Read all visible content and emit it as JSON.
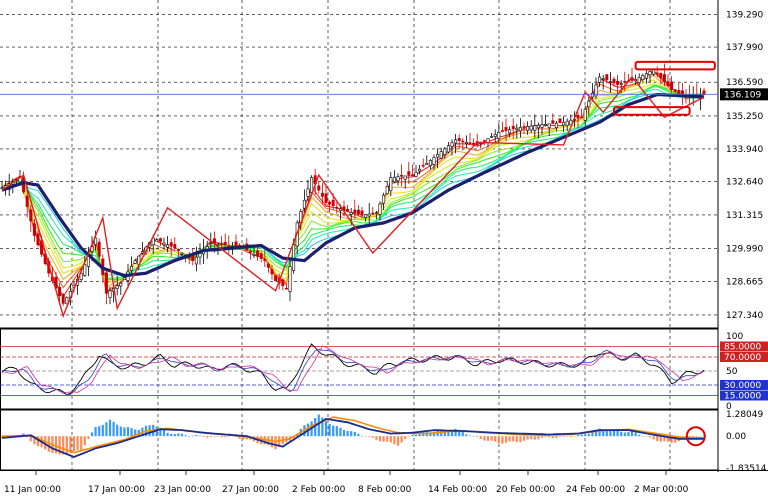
{
  "price_axis": {
    "labels": [
      "139.290",
      "137.990",
      "136.590",
      "135.250",
      "133.940",
      "132.640",
      "131.315",
      "129.990",
      "128.665",
      "127.340"
    ],
    "values": [
      139.29,
      137.99,
      136.59,
      135.25,
      133.94,
      132.64,
      131.315,
      129.99,
      128.665,
      127.34
    ],
    "current_price": "136.109",
    "current_value": 136.109
  },
  "rsi_axis": {
    "labels": [
      "100",
      "85.0000",
      "70.0000",
      "50",
      "30.0000",
      "15.0000",
      "0"
    ],
    "values": [
      100,
      85,
      70,
      50,
      30,
      15,
      0
    ],
    "tagged": [
      false,
      true,
      true,
      false,
      true,
      true,
      false
    ]
  },
  "macd_axis": {
    "labels": [
      "1.28049",
      "0.00",
      "-1.83514"
    ],
    "values": [
      1.28049,
      0.0,
      -1.83514
    ]
  },
  "time_axis": {
    "labels": [
      "11 Jan 00:00",
      "17 Jan 00:00",
      "23 Jan 00:00",
      "27 Jan 00:00",
      "2 Feb 00:00",
      "8 Feb 00:00",
      "14 Feb 00:00",
      "20 Feb 00:00",
      "24 Feb 00:00",
      "2 Mar 00:00"
    ]
  },
  "colors": {
    "background": "#ffffff",
    "grid": "#000000",
    "bull_candle": "#000000",
    "bear_candle": "#cc0000",
    "ma_slow": "#1a1f6e",
    "zigzag": "#e02020",
    "current_line": "#4a6cd4",
    "rsi_level_high": "#cc2222",
    "rsi_level_low": "#2233cc",
    "macd_pos": "#3399ff",
    "macd_neg": "#ff8855",
    "macd_signal": "#ff8c00",
    "macd_line": "#1a2c8c",
    "annotation": "#e00000"
  },
  "chart_data": [
    {
      "type": "candlestick",
      "title": "",
      "x_labels": [
        "11 Jan 00:00",
        "17 Jan 00:00",
        "23 Jan 00:00",
        "27 Jan 00:00",
        "2 Feb 00:00",
        "8 Feb 00:00",
        "14 Feb 00:00",
        "20 Feb 00:00",
        "24 Feb 00:00",
        "2 Mar 00:00"
      ],
      "ylim": [
        126.9,
        139.7
      ],
      "ma_ribbon": "rainbow",
      "slow_ma_key": [
        [
          0,
          132.3
        ],
        [
          6,
          132.6
        ],
        [
          10,
          132.5
        ],
        [
          16,
          131.2
        ],
        [
          22,
          130.0
        ],
        [
          28,
          129.2
        ],
        [
          34,
          128.9
        ],
        [
          40,
          129.0
        ],
        [
          48,
          129.5
        ],
        [
          56,
          129.9
        ],
        [
          64,
          130.0
        ],
        [
          72,
          130.1
        ],
        [
          78,
          129.6
        ],
        [
          84,
          129.5
        ],
        [
          90,
          130.2
        ],
        [
          98,
          130.8
        ],
        [
          106,
          131.0
        ],
        [
          114,
          131.4
        ],
        [
          124,
          132.3
        ],
        [
          134,
          133.0
        ],
        [
          146,
          133.8
        ],
        [
          156,
          134.4
        ],
        [
          166,
          135.0
        ],
        [
          174,
          135.7
        ],
        [
          182,
          136.1
        ],
        [
          190,
          136.05
        ],
        [
          195,
          136.0
        ]
      ],
      "close_key": [
        [
          0,
          132.4
        ],
        [
          5,
          132.8
        ],
        [
          9,
          130.5
        ],
        [
          13,
          129.0
        ],
        [
          17,
          127.8
        ],
        [
          22,
          129.0
        ],
        [
          26,
          130.4
        ],
        [
          29,
          128.2
        ],
        [
          33,
          128.6
        ],
        [
          37,
          129.5
        ],
        [
          42,
          130.4
        ],
        [
          48,
          130.0
        ],
        [
          53,
          129.5
        ],
        [
          58,
          130.2
        ],
        [
          63,
          130.1
        ],
        [
          67,
          130.0
        ],
        [
          73,
          129.5
        ],
        [
          76,
          128.7
        ],
        [
          79,
          128.4
        ],
        [
          82,
          131.0
        ],
        [
          86,
          132.8
        ],
        [
          90,
          131.8
        ],
        [
          95,
          131.5
        ],
        [
          100,
          131.3
        ],
        [
          104,
          131.4
        ],
        [
          108,
          132.8
        ],
        [
          114,
          132.9
        ],
        [
          120,
          133.6
        ],
        [
          126,
          134.3
        ],
        [
          132,
          134.1
        ],
        [
          138,
          134.6
        ],
        [
          144,
          134.8
        ],
        [
          150,
          134.9
        ],
        [
          156,
          135.0
        ],
        [
          161,
          135.2
        ],
        [
          166,
          136.8
        ],
        [
          171,
          136.5
        ],
        [
          176,
          136.7
        ],
        [
          181,
          137.1
        ],
        [
          186,
          136.3
        ],
        [
          190,
          136.0
        ],
        [
          195,
          136.1
        ]
      ],
      "zigzag": [
        [
          0,
          132.3
        ],
        [
          6,
          132.9
        ],
        [
          17,
          127.3
        ],
        [
          28,
          131.2
        ],
        [
          32,
          127.6
        ],
        [
          46,
          131.6
        ],
        [
          76,
          128.3
        ],
        [
          88,
          132.9
        ],
        [
          103,
          129.8
        ],
        [
          132,
          134.2
        ],
        [
          156,
          134.1
        ],
        [
          162,
          136.2
        ],
        [
          167,
          135.4
        ],
        [
          175,
          136.8
        ],
        [
          184,
          135.2
        ],
        [
          195,
          136.0
        ]
      ],
      "annotations": [
        {
          "kind": "rect",
          "x0": 176,
          "x1": 198,
          "y0": 137.4,
          "y1": 137.1
        },
        {
          "kind": "rect",
          "x0": 170,
          "x1": 191,
          "y0": 135.6,
          "y1": 135.3
        }
      ]
    },
    {
      "type": "line",
      "title": "",
      "ylim": [
        0,
        100
      ],
      "levels": [
        85,
        70,
        50,
        30,
        15
      ],
      "series_key": [
        [
          0,
          48
        ],
        [
          4,
          55
        ],
        [
          8,
          30
        ],
        [
          13,
          22
        ],
        [
          18,
          18
        ],
        [
          22,
          35
        ],
        [
          27,
          74
        ],
        [
          30,
          60
        ],
        [
          35,
          55
        ],
        [
          40,
          62
        ],
        [
          44,
          70
        ],
        [
          48,
          58
        ],
        [
          53,
          60
        ],
        [
          58,
          52
        ],
        [
          63,
          58
        ],
        [
          67,
          55
        ],
        [
          72,
          45
        ],
        [
          76,
          25
        ],
        [
          79,
          22
        ],
        [
          82,
          50
        ],
        [
          86,
          85
        ],
        [
          90,
          75
        ],
        [
          95,
          62
        ],
        [
          100,
          55
        ],
        [
          104,
          48
        ],
        [
          108,
          60
        ],
        [
          114,
          65
        ],
        [
          120,
          68
        ],
        [
          126,
          70
        ],
        [
          132,
          60
        ],
        [
          138,
          66
        ],
        [
          144,
          64
        ],
        [
          150,
          60
        ],
        [
          156,
          58
        ],
        [
          161,
          60
        ],
        [
          166,
          78
        ],
        [
          171,
          68
        ],
        [
          176,
          72
        ],
        [
          181,
          60
        ],
        [
          186,
          35
        ],
        [
          190,
          45
        ],
        [
          195,
          52
        ]
      ]
    },
    {
      "type": "bar",
      "title": "",
      "ylim": [
        -1.83514,
        1.28049
      ],
      "hist_key": [
        [
          0,
          -0.1
        ],
        [
          6,
          0.1
        ],
        [
          10,
          -0.6
        ],
        [
          16,
          -1.1
        ],
        [
          22,
          -0.8
        ],
        [
          26,
          0.5
        ],
        [
          30,
          0.9
        ],
        [
          34,
          0.5
        ],
        [
          38,
          0.4
        ],
        [
          42,
          0.7
        ],
        [
          46,
          0.2
        ],
        [
          52,
          0.05
        ],
        [
          58,
          -0.05
        ],
        [
          64,
          0.0
        ],
        [
          70,
          -0.3
        ],
        [
          76,
          -0.7
        ],
        [
          80,
          -0.3
        ],
        [
          84,
          0.6
        ],
        [
          88,
          1.2
        ],
        [
          92,
          0.6
        ],
        [
          98,
          0.2
        ],
        [
          104,
          -0.2
        ],
        [
          110,
          -0.5
        ],
        [
          114,
          0.1
        ],
        [
          120,
          0.3
        ],
        [
          126,
          0.4
        ],
        [
          132,
          -0.1
        ],
        [
          138,
          -0.4
        ],
        [
          144,
          -0.3
        ],
        [
          150,
          -0.1
        ],
        [
          156,
          -0.05
        ],
        [
          161,
          0.05
        ],
        [
          166,
          0.4
        ],
        [
          171,
          0.3
        ],
        [
          176,
          0.2
        ],
        [
          181,
          -0.2
        ],
        [
          186,
          -0.4
        ],
        [
          190,
          -0.1
        ],
        [
          195,
          0.0
        ]
      ],
      "signal_key": [
        [
          0,
          0.0
        ],
        [
          8,
          0.05
        ],
        [
          14,
          -0.5
        ],
        [
          20,
          -0.95
        ],
        [
          28,
          -0.5
        ],
        [
          34,
          -0.2
        ],
        [
          40,
          0.3
        ],
        [
          46,
          0.45
        ],
        [
          52,
          0.3
        ],
        [
          58,
          0.15
        ],
        [
          64,
          0.05
        ],
        [
          70,
          -0.1
        ],
        [
          76,
          -0.3
        ],
        [
          80,
          -0.15
        ],
        [
          86,
          0.6
        ],
        [
          92,
          1.1
        ],
        [
          98,
          0.9
        ],
        [
          104,
          0.5
        ],
        [
          110,
          0.2
        ],
        [
          118,
          0.15
        ],
        [
          126,
          0.3
        ],
        [
          134,
          0.25
        ],
        [
          142,
          0.1
        ],
        [
          150,
          0.05
        ],
        [
          158,
          0.1
        ],
        [
          166,
          0.3
        ],
        [
          174,
          0.4
        ],
        [
          182,
          0.15
        ],
        [
          188,
          -0.05
        ],
        [
          195,
          -0.1
        ]
      ],
      "macd_key": [
        [
          0,
          -0.1
        ],
        [
          8,
          0.05
        ],
        [
          14,
          -0.7
        ],
        [
          20,
          -1.2
        ],
        [
          26,
          -0.7
        ],
        [
          32,
          -0.4
        ],
        [
          38,
          0.0
        ],
        [
          44,
          0.4
        ],
        [
          50,
          0.35
        ],
        [
          56,
          0.2
        ],
        [
          62,
          0.1
        ],
        [
          68,
          0.0
        ],
        [
          74,
          -0.4
        ],
        [
          78,
          -0.6
        ],
        [
          84,
          0.2
        ],
        [
          90,
          1.0
        ],
        [
          96,
          0.8
        ],
        [
          102,
          0.4
        ],
        [
          108,
          0.15
        ],
        [
          114,
          0.2
        ],
        [
          120,
          0.35
        ],
        [
          128,
          0.3
        ],
        [
          136,
          0.2
        ],
        [
          144,
          0.15
        ],
        [
          152,
          0.1
        ],
        [
          160,
          0.15
        ],
        [
          166,
          0.35
        ],
        [
          174,
          0.35
        ],
        [
          182,
          0.05
        ],
        [
          188,
          -0.15
        ],
        [
          195,
          -0.15
        ]
      ],
      "circle_marker": {
        "x_index": 193,
        "value": 0.0
      }
    }
  ]
}
